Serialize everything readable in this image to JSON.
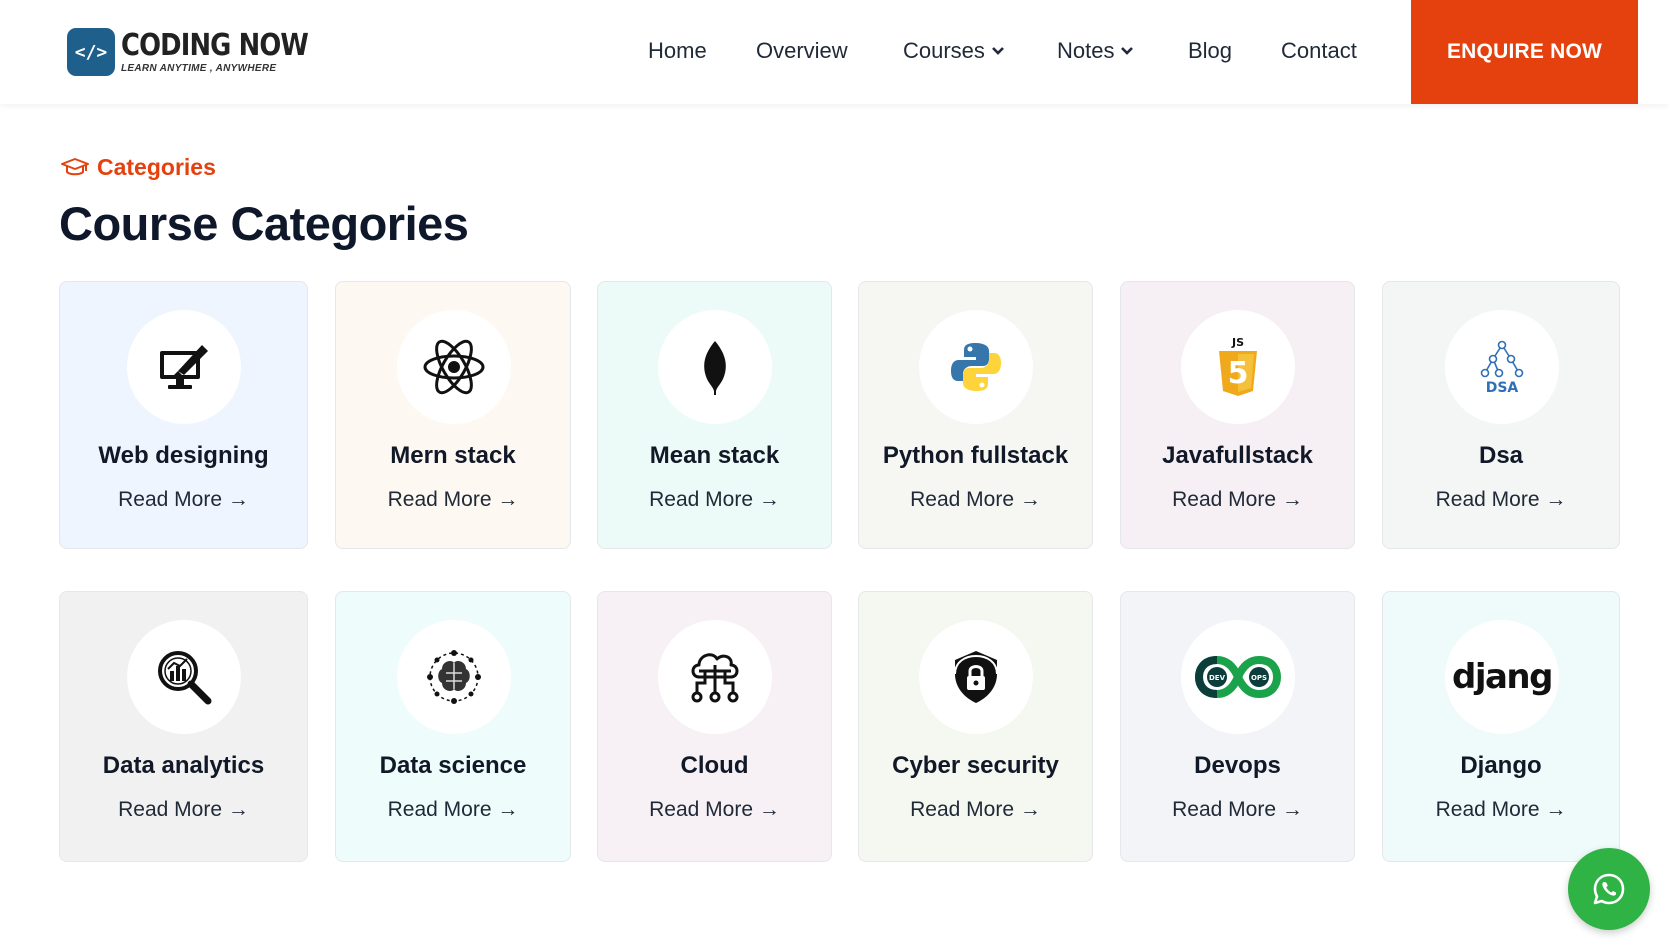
{
  "header": {
    "logo_title": "CODING NOW",
    "logo_subtitle": "LEARN ANYTIME , ANYWHERE",
    "logo_glyph": "</>",
    "nav": [
      {
        "label": "Home",
        "has_dropdown": false
      },
      {
        "label": "Overview",
        "has_dropdown": false
      },
      {
        "label": "Courses",
        "has_dropdown": true
      },
      {
        "label": "Notes",
        "has_dropdown": true
      },
      {
        "label": "Blog",
        "has_dropdown": false
      },
      {
        "label": "Contact",
        "has_dropdown": false
      }
    ],
    "enquire_label": "ENQUIRE NOW"
  },
  "section": {
    "tag": "Categories",
    "title": "Course Categories"
  },
  "read_more": "Read More →",
  "colors": {
    "accent": "#e5410f",
    "whatsapp": "#2fb344"
  },
  "categories": [
    {
      "title": "Web designing",
      "icon": "monitor-pen-icon",
      "bg": "#eef5fe"
    },
    {
      "title": "Mern stack",
      "icon": "react-atom-icon",
      "bg": "#fdf8f1"
    },
    {
      "title": "Mean stack",
      "icon": "mongodb-leaf-icon",
      "bg": "#ecfbf8"
    },
    {
      "title": "Python fullstack",
      "icon": "python-icon",
      "bg": "#f6f7f3"
    },
    {
      "title": "Javafullstack",
      "icon": "js-shield-icon",
      "bg": "#f6eff4"
    },
    {
      "title": "Dsa",
      "icon": "dsa-tree-icon",
      "bg": "#f3f6f4"
    },
    {
      "title": "Data analytics",
      "icon": "magnifier-chart-icon",
      "bg": "#f1f1f1"
    },
    {
      "title": "Data science",
      "icon": "brain-network-icon",
      "bg": "#eefcfb"
    },
    {
      "title": "Cloud",
      "icon": "cloud-network-icon",
      "bg": "#f7f1f5"
    },
    {
      "title": "Cyber security",
      "icon": "shield-lock-icon",
      "bg": "#f5f7f1"
    },
    {
      "title": "Devops",
      "icon": "devops-infinity-icon",
      "bg": "#f3f4f7"
    },
    {
      "title": "Django",
      "icon": "django-logo-icon",
      "bg": "#effafb"
    }
  ],
  "icon_text": {
    "js": "JS",
    "dsa": "DSA",
    "dev": "DEV",
    "ops": "OPS",
    "django": "djang"
  }
}
